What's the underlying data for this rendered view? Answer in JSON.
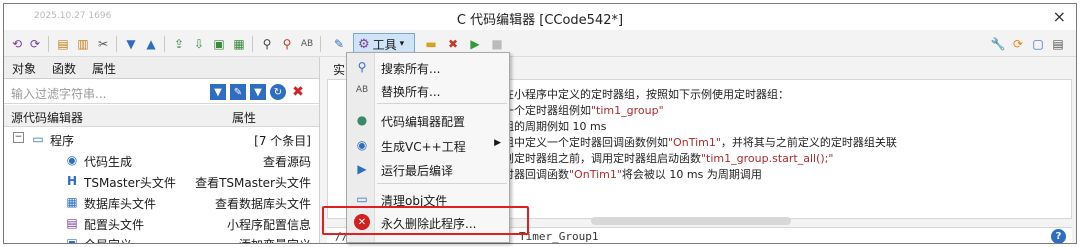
{
  "window": {
    "stamp": "2025.10.27 1696",
    "title": "C 代码编辑器 [CCode542*]",
    "close": "×"
  },
  "toolbar": {
    "tools_label": "工具",
    "tools_arrow": "▾"
  },
  "left_panel": {
    "tabs": [
      "对象",
      "函数",
      "属性"
    ],
    "filter_placeholder": "输入过滤字符串...",
    "header": {
      "name": "源代码编辑器",
      "value": "属性"
    },
    "rows": [
      {
        "name": "程序",
        "value": "[7 个条目]",
        "expander": "⊟"
      },
      {
        "name": "代码生成",
        "value": "查看源码"
      },
      {
        "name": "TSMaster头文件",
        "value": "查看TSMaster头文件"
      },
      {
        "name": "数据库头文件",
        "value": "查看数据库头文件"
      },
      {
        "name": "配置头文件",
        "value": "小程序配置信息"
      },
      {
        "name": "全局定义",
        "value": "添加变量定义"
      }
    ]
  },
  "editor": {
    "tab_label": "实",
    "code_lines": [
      {
        "pre": "在小程序中定义的定时器组，按照如下示例使用定时器组：",
        "str": "",
        "post": ""
      },
      {
        "pre": "一个定时器组例如",
        "str": "\"tim1_group\"",
        "post": ""
      },
      {
        "pre": "组的周期例如 10 ms",
        "str": "",
        "post": ""
      },
      {
        "pre": "组中定义一个定时器回调函数例如",
        "str": "\"OnTim1\"",
        "post": "，并将其与之前定义的定时器组关联"
      },
      {
        "pre": "创定时器组之前，调用定时器组启动函数",
        "str": "\"tim1_group.start_all();\"",
        "post": ""
      },
      {
        "pre": "时器回调函数",
        "str": "\"OnTim1\"",
        "post": "将会被以 10 ms 为周期调用"
      }
    ],
    "bottom_comment": "//",
    "bottom_text": "Timer_Group1",
    "help": "?"
  },
  "tools_menu": {
    "items": [
      {
        "label": "搜索所有...",
        "icon": "search-icon"
      },
      {
        "label": "替换所有...",
        "icon": "replace-icon"
      },
      {
        "label": "代码编辑器配置",
        "icon": "palette-icon"
      },
      {
        "label": "生成VC++工程",
        "icon": "vc-project-icon",
        "submenu": "▶"
      },
      {
        "label": "运行最后编译",
        "icon": "run-icon"
      },
      {
        "label": "清理obj文件",
        "icon": "clean-icon"
      },
      {
        "label": "永久删除此程序...",
        "icon": "delete-icon"
      }
    ]
  },
  "colors": {
    "accent": "#2f6dc2",
    "highlight_red": "#e02020",
    "menu_bg": "#f7f7f7",
    "string_red": "#b02a2a"
  }
}
